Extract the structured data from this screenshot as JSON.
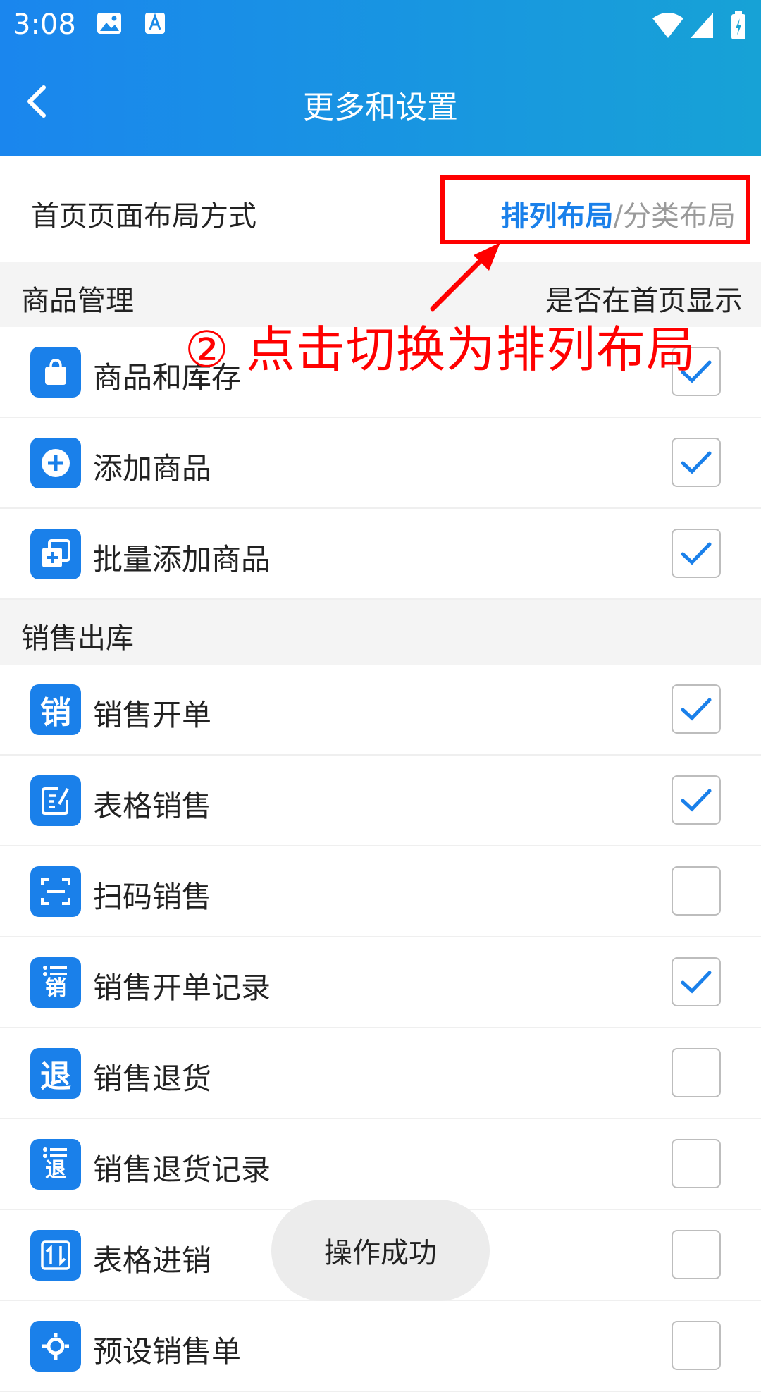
{
  "status_bar": {
    "time": "3:08"
  },
  "header": {
    "title": "更多和设置"
  },
  "layout_setting": {
    "label": "首页页面布局方式",
    "option_active": "排列布局",
    "separator": "/",
    "option_inactive": "分类布局"
  },
  "annotation": {
    "text": "② 点击切换为排列布局",
    "color": "#ff0000"
  },
  "sections": [
    {
      "title": "商品管理",
      "right_label": "是否在首页显示",
      "items": [
        {
          "label": "商品和库存",
          "icon": "shopping-bag-icon",
          "checked": true
        },
        {
          "label": "添加商品",
          "icon": "plus-circle-icon",
          "checked": true
        },
        {
          "label": "批量添加商品",
          "icon": "batch-add-icon",
          "checked": true
        }
      ]
    },
    {
      "title": "销售出库",
      "items": [
        {
          "label": "销售开单",
          "icon": "sales-order-icon",
          "icon_text": "销",
          "checked": true
        },
        {
          "label": "表格销售",
          "icon": "table-edit-icon",
          "checked": true
        },
        {
          "label": "扫码销售",
          "icon": "scan-icon",
          "checked": false
        },
        {
          "label": "销售开单记录",
          "icon": "sales-record-icon",
          "icon_text": "销",
          "checked": true
        },
        {
          "label": "销售退货",
          "icon": "return-icon",
          "icon_text": "退",
          "checked": false
        },
        {
          "label": "销售退货记录",
          "icon": "return-record-icon",
          "icon_text": "退",
          "checked": false
        },
        {
          "label": "表格进销",
          "icon": "table-transfer-icon",
          "checked": false
        },
        {
          "label": "预设销售单",
          "icon": "preset-order-icon",
          "checked": false
        }
      ]
    }
  ],
  "toast": {
    "text": "操作成功"
  },
  "colors": {
    "accent": "#1a80ea",
    "header_start": "#1a86ee",
    "header_end": "#17a2d6",
    "annotation": "#ff0000"
  }
}
